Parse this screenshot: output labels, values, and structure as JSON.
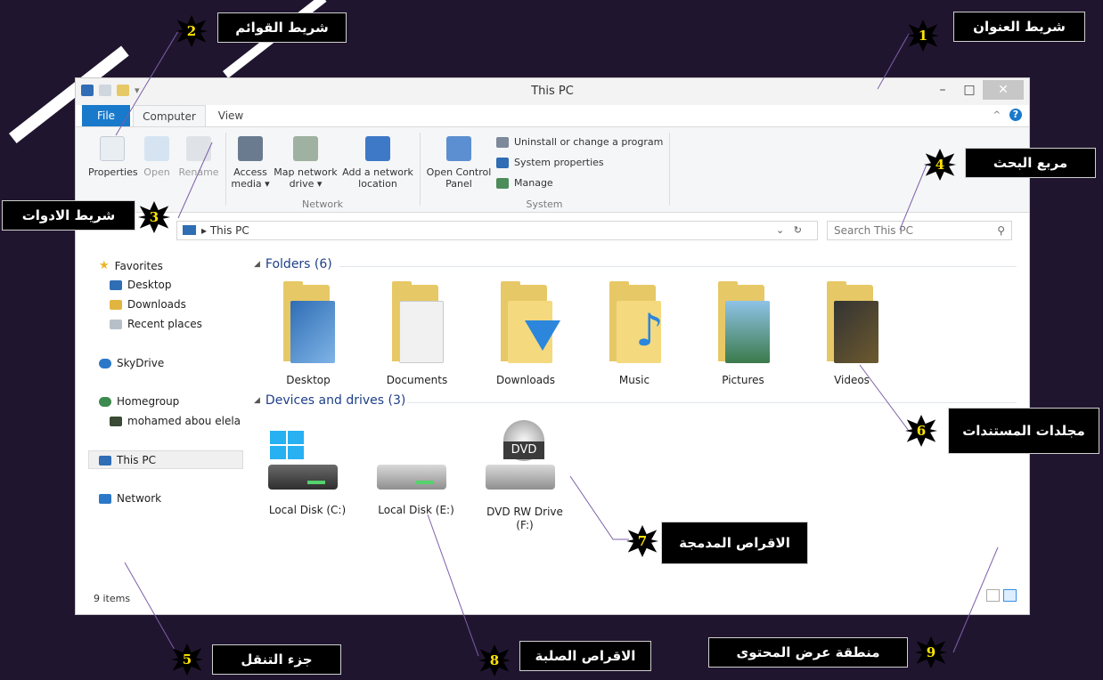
{
  "window": {
    "title": "This PC",
    "minimize": "–",
    "maximize": "□",
    "close": "✕",
    "tabs": {
      "file": "File",
      "computer": "Computer",
      "view": "View"
    },
    "help": "?",
    "ribbon": {
      "location": {
        "properties": "Properties",
        "open": "Open",
        "rename": "Rename"
      },
      "network_group": "Network",
      "access_media": "Access media ▾",
      "map_network_drive": "Map network drive ▾",
      "add_network_location": "Add a network location",
      "system_group": "System",
      "open_control_panel": "Open Control Panel",
      "uninstall": "Uninstall or change a program",
      "system_properties": "System properties",
      "manage": "Manage"
    },
    "address": {
      "path": "This PC",
      "dropdown": "⌄",
      "refresh": "↻"
    },
    "search": {
      "placeholder": "Search This PC"
    },
    "nav": {
      "favorites": "Favorites",
      "desktop": "Desktop",
      "downloads": "Downloads",
      "recent_places": "Recent places",
      "skydrive": "SkyDrive",
      "homegroup": "Homegroup",
      "user": "mohamed abou elela",
      "this_pc": "This PC",
      "network": "Network"
    },
    "content": {
      "folders_header": "Folders (6)",
      "folders": [
        "Desktop",
        "Documents",
        "Downloads",
        "Music",
        "Pictures",
        "Videos"
      ],
      "devices_header": "Devices and drives (3)",
      "drives": [
        "Local Disk (C:)",
        "Local Disk (E:)",
        "DVD RW Drive\n(F:)"
      ],
      "dvd_badge": "DVD"
    },
    "status": "9 items"
  },
  "callouts": {
    "c1": {
      "num": "1",
      "text": "شريط العنوان"
    },
    "c2": {
      "num": "2",
      "text": "شريط القوائم"
    },
    "c3": {
      "num": "3",
      "text": "شريط الادوات"
    },
    "c4": {
      "num": "4",
      "text": "مربع البحث"
    },
    "c5": {
      "num": "5",
      "text": "جزء التنقل"
    },
    "c6": {
      "num": "6",
      "text": "مجلدات المستندات"
    },
    "c7": {
      "num": "7",
      "text": "الاقراص المدمجة"
    },
    "c8": {
      "num": "8",
      "text": "الاقراص الصلبة"
    },
    "c9": {
      "num": "9",
      "text": "منطقة عرض المحتوى"
    }
  },
  "colors": {
    "background": "#20152f",
    "accent": "#1979ca",
    "badge_number": "#ffe400"
  }
}
